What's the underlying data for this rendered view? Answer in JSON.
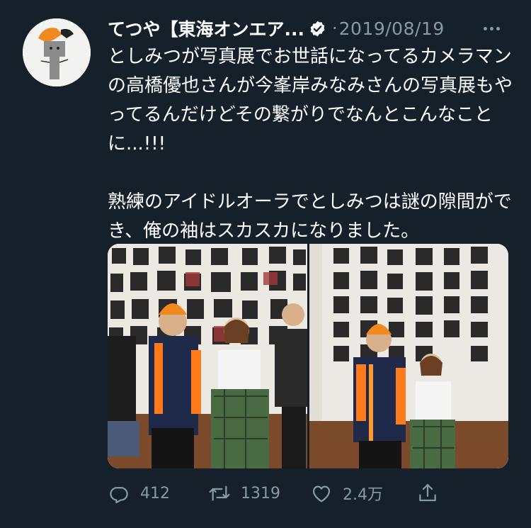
{
  "tweet": {
    "author_name": "てつや【東海オンエア...",
    "verified": true,
    "dot": "·",
    "date": "2019/08/19",
    "text_paragraphs": [
      "としみつが写真展でお世話になってるカメラマンの高橋優也さんが今峯岸みなみさんの写真展もやってるんだけどその繋がりでなんとこんなことに...!!!",
      "熟練のアイドルオーラでとしみつは謎の隙間ができ、俺の袖はスカスカになりました。"
    ]
  },
  "actions": {
    "reply_count": "412",
    "retweet_count": "1319",
    "like_count": "2.4万"
  },
  "icons": {
    "reply": "reply-icon",
    "retweet": "retweet-icon",
    "like": "like-icon",
    "share": "share-icon",
    "verified": "verified-badge-icon",
    "more": "more-icon"
  },
  "colors": {
    "background": "#15202b",
    "secondary_text": "#8899a6",
    "primary_text": "#ffffff"
  }
}
